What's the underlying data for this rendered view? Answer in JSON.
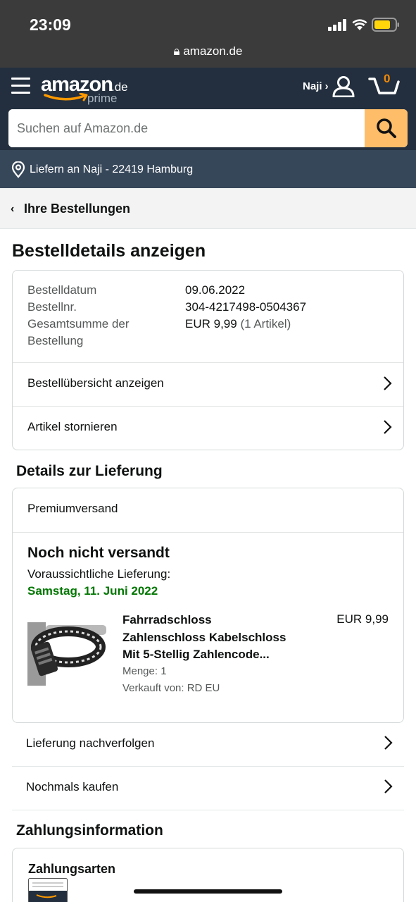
{
  "status": {
    "time": "23:09",
    "url": "amazon.de"
  },
  "header": {
    "logo_word": "amazon",
    "logo_tld": ".de",
    "logo_prime": "prime",
    "account_label": "Naji ›",
    "cart_count": "0",
    "search_placeholder": "Suchen auf Amazon.de",
    "accent": "#febd69",
    "bg": "#232f3e"
  },
  "deliver": {
    "text": "Liefern an Naji - 22419 Hamburg"
  },
  "breadcrumb": {
    "chevron": "‹",
    "label": "Ihre Bestellungen"
  },
  "page_title": "Bestelldetails anzeigen",
  "order": {
    "date_label": "Bestelldatum",
    "date_value": "09.06.2022",
    "number_label": "Bestellnr.",
    "number_value": "304-4217498-0504367",
    "total_label_1": "Gesamtsumme der",
    "total_label_2": "Bestellung",
    "total_value": "EUR 9,99",
    "total_count": "(1 Artikel)",
    "links": [
      "Bestellübersicht anzeigen",
      "Artikel stornieren"
    ]
  },
  "delivery": {
    "section_title": "Details zur Lieferung",
    "shipping_method": "Premiumversand",
    "status": "Noch nicht versandt",
    "expected_label": "Voraussichtliche Lieferung:",
    "expected_date": "Samstag, 11. Juni 2022",
    "expected_color": "#007600",
    "item": {
      "title_1": "Fahrradschloss",
      "title_2": "Zahlenschloss Kabelschloss",
      "title_3": "Mit 5-Stellig Zahlencode...",
      "price": "EUR 9,99",
      "quantity": "Menge: 1",
      "seller": "Verkauft von: RD EU"
    },
    "links": [
      "Lieferung nachverfolgen",
      "Nochmals kaufen"
    ]
  },
  "payment": {
    "section_title": "Zahlungsinformation",
    "methods_label": "Zahlungsarten"
  }
}
